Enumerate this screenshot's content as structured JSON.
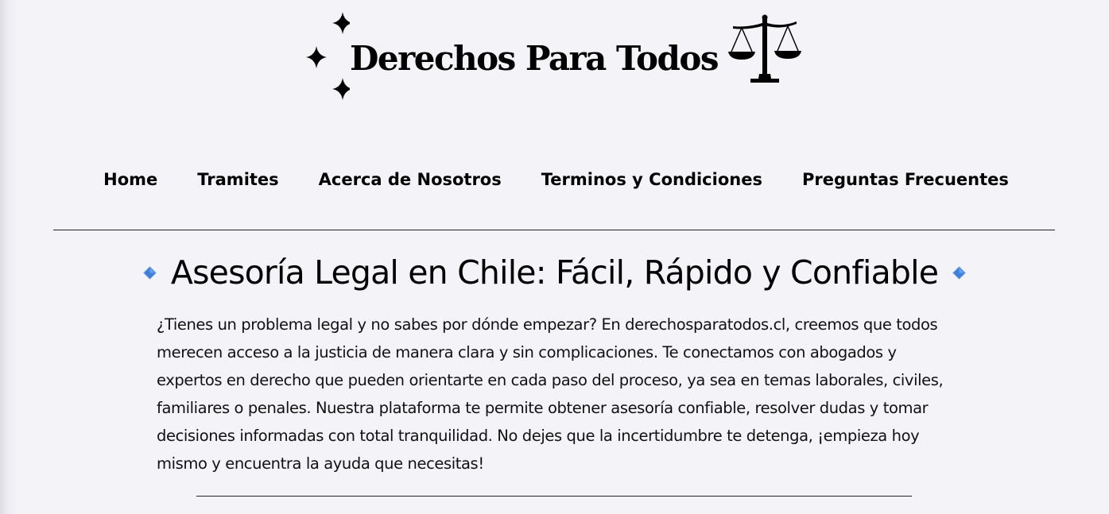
{
  "site": {
    "title": "Derechos Para Todos",
    "logo_icons": [
      "sparkle-stars-icon",
      "scales-of-justice-icon"
    ]
  },
  "nav": {
    "items": [
      {
        "label": "Home"
      },
      {
        "label": "Tramites"
      },
      {
        "label": "Acerca de Nosotros"
      },
      {
        "label": "Terminos y Condiciones"
      },
      {
        "label": "Preguntas Frecuentes"
      }
    ]
  },
  "hero": {
    "heading": "Asesoría Legal en Chile: Fácil, Rápido y Confiable",
    "heading_icon": "blue-diamond-icon",
    "body": "¿Tienes un problema legal y no sabes por dónde empezar? En derechosparatodos.cl, creemos que todos merecen acceso a la justicia de manera clara y sin complicaciones. Te conectamos con abogados y expertos en derecho que pueden orientarte en cada paso del proceso, ya sea en temas laborales, civiles, familiares o penales. Nuestra plataforma te permite obtener asesoría confiable, resolver dudas y tomar decisiones informadas con total tranquilidad. No dejes que la incertidumbre te detenga, ¡empieza hoy mismo y encuentra la ayuda que necesitas!"
  },
  "colors": {
    "background": "#f3f3f8",
    "text": "#000000",
    "diamond_accent": "#3d7fd9"
  }
}
